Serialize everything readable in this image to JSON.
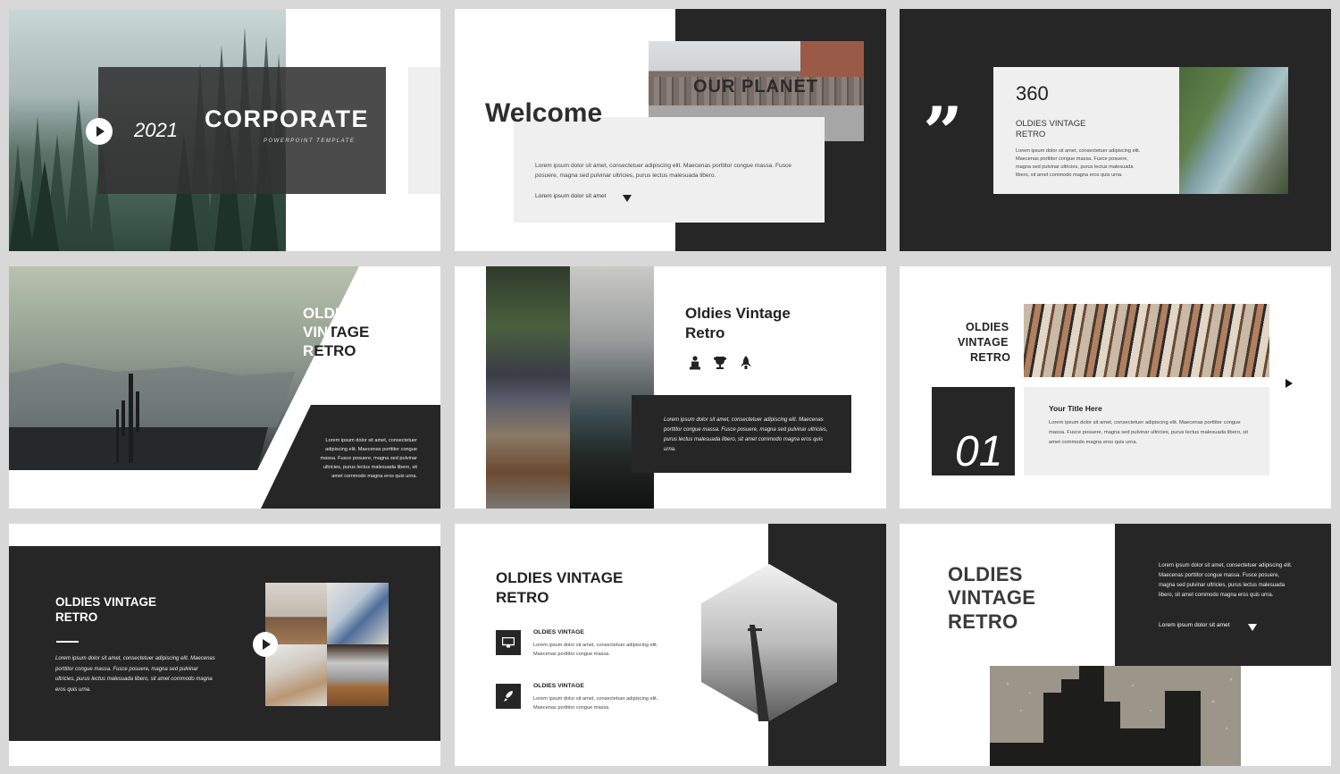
{
  "slide1": {
    "year": "2021",
    "title": "CORPORATE",
    "subtitle": "POWERPOINT TEMPLATE"
  },
  "slide2": {
    "title": "Welcome",
    "graffiti": "OUR PLANET",
    "body": "Lorem ipsum dolor sit amet, consectetuer adipiscing elit. Maecenas porttitor congue massa. Fusce posuere, magna sed pulvinar ultricies, purus lectus malesuada libero.",
    "link": "Lorem ipsum dolor sit amet"
  },
  "slide3": {
    "quote_mark": "”",
    "number": "360",
    "heading_l1": "OLDIES VINTAGE",
    "heading_l2": "RETRO",
    "body": "Lorem ipsum dolor sit amet, consectetuer adipiscing elit. Maecenas porttitor congue massa. Fusce posuere, magna sed pulvinar ultricies, purus lectus malesuada libero, sit amet commodo magna eros quis urna."
  },
  "slide4": {
    "title_l1": "OLDIES",
    "title_l2": "VINTAGE",
    "title_l3": "RETRO",
    "body": "Lorem ipsum dolor sit amet, consectetuer adipiscing elit. Maecenas porttitor congue massa. Fusce posuere, magna sed pulvinar ultricies, purus lectus malesuada libero, sit amet commodo magna eros quis urna."
  },
  "slide5": {
    "title_l1": "Oldies Vintage",
    "title_l2": "Retro",
    "body": "Lorem ipsum dolor sit amet, consectetuer adipiscing elit. Maecenas porttitor congue massa. Fusce posuere, magna sed pulvinar ultricies, purus lectus malesuada libero, sit amet commodo magna eros quis urna."
  },
  "slide6": {
    "heading_l1": "OLDIES",
    "heading_l2": "VINTAGE",
    "heading_l3": "RETRO",
    "number": "01",
    "card_title": "Your Title Here",
    "card_body": "Lorem ipsum dolor sit amet, consectetuer adipiscing elit. Maecenas porttitor congue massa. Fusce posuere, magna sed pulvinar ultricies, purus lectus malesuada libero, sit amet commodo magna eros quis urna."
  },
  "slide7": {
    "title_l1": "OLDIES VINTAGE",
    "title_l2": "RETRO",
    "body": "Lorem ipsum dolor sit amet, consectetuer adipiscing elit. Maecenas porttitor congue massa. Fusce posuere, magna sed pulvinar ultricies, purus lectus malesuada libero, sit amet commodo magna eros quis urna."
  },
  "slide8": {
    "title_l1": "OLDIES VINTAGE",
    "title_l2": "RETRO",
    "items": [
      {
        "title": "OLDIES VINTAGE",
        "body": "Lorem ipsum dolor sit amet, consectetuer adipiscing elit. Maecenas porttitor congue massa.",
        "icon": "monitor-icon"
      },
      {
        "title": "OLDIES VINTAGE",
        "body": "Lorem ipsum dolor sit amet, consectetuer adipiscing elit. Maecenas porttitor congue massa.",
        "icon": "rocket-icon"
      }
    ]
  },
  "slide9": {
    "title_l1": "OLDIES",
    "title_l2": "VINTAGE",
    "title_l3": "RETRO",
    "body": "Lorem ipsum dolor sit amet, consectetuer adipiscing elit. Maecenas porttitor congue massa. Fusce posuere, magna sed pulvinar ultricies, purus lectus malesuada libero, sit amet commodo magna eros quis urna.",
    "link": "Lorem ipsum dolor sit amet"
  }
}
